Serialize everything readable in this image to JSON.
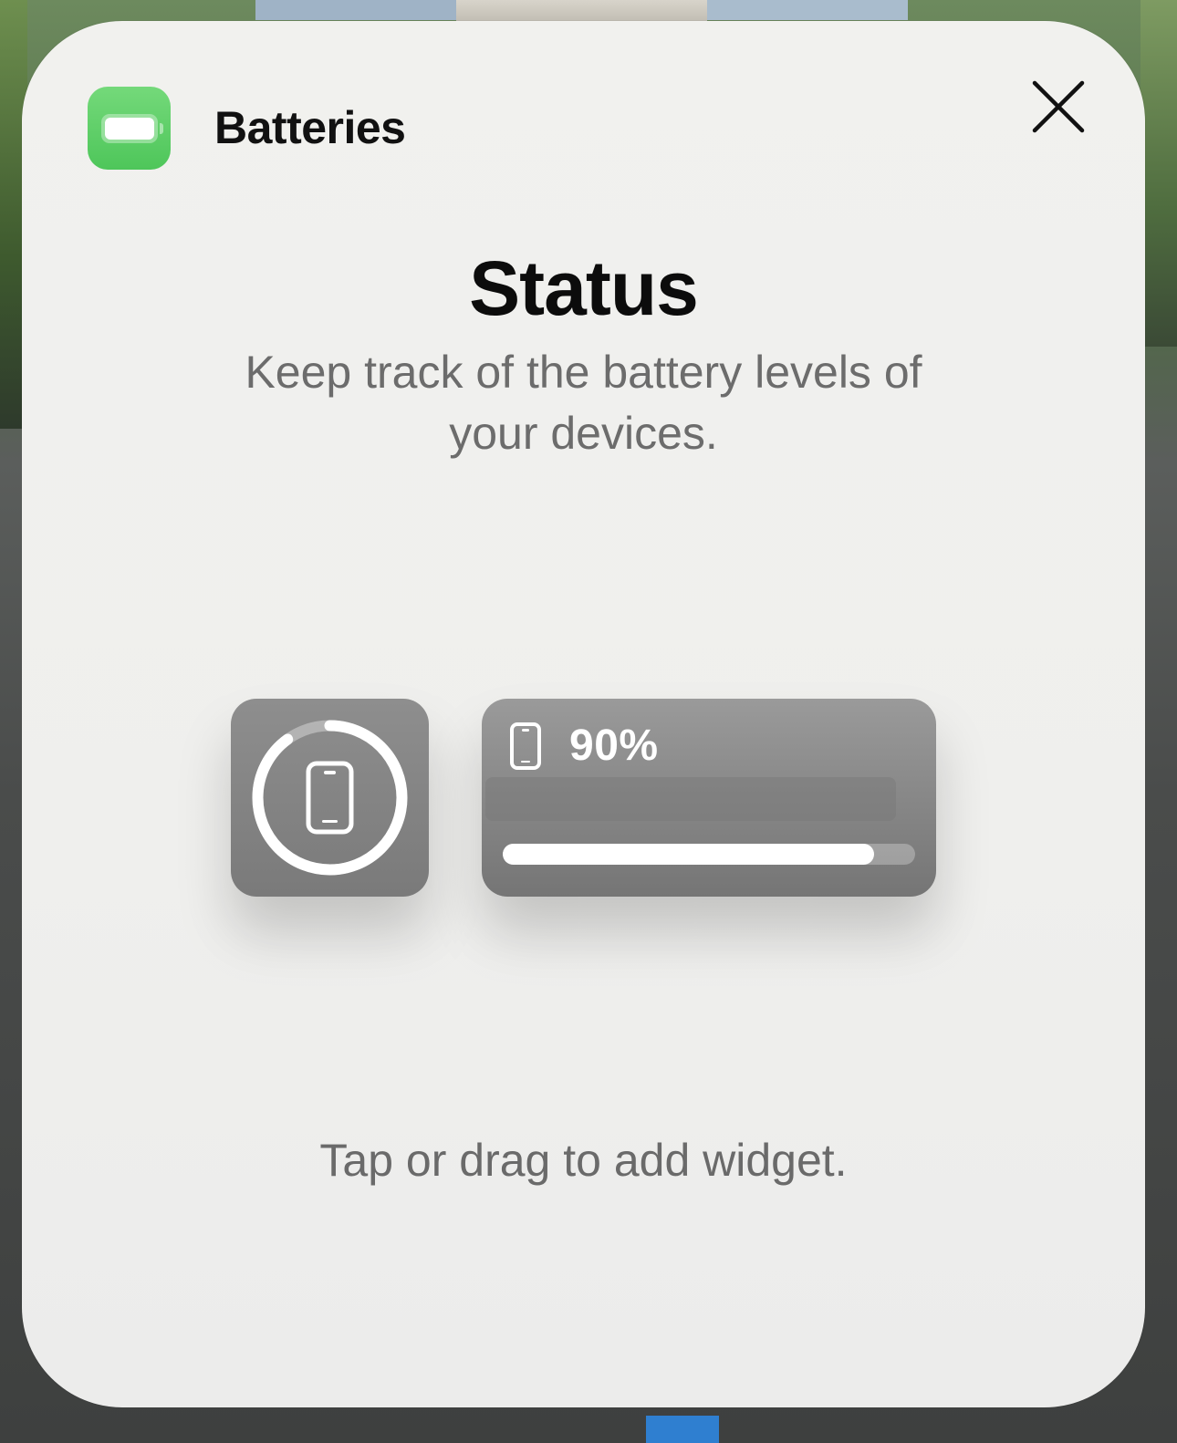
{
  "header": {
    "app_name": "Batteries",
    "app_icon": "battery-icon",
    "close_icon": "close-icon"
  },
  "content": {
    "title": "Status",
    "description": "Keep track of the battery levels of your devices.",
    "hint": "Tap or drag to add widget."
  },
  "widgets": {
    "small": {
      "device_icon": "iphone-icon",
      "level": 0.9
    },
    "medium": {
      "device_icon": "iphone-icon",
      "percent_label": "90%",
      "level": 0.9
    }
  },
  "colors": {
    "app_icon_green": "#4ec65a",
    "sheet_background": "#efefed",
    "widget_gray": "#7a7a7a"
  }
}
